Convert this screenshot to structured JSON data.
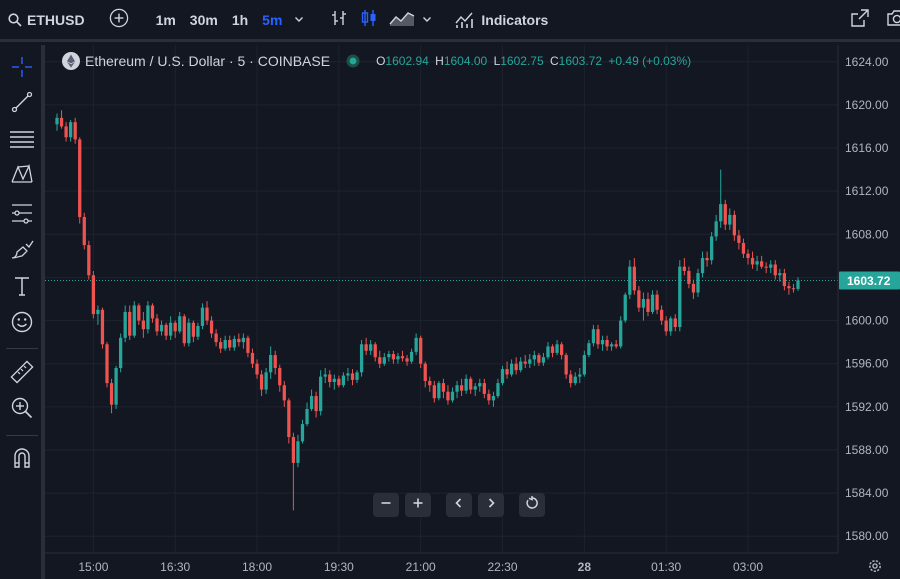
{
  "topbar": {
    "symbol": "ETHUSD",
    "timeframes": [
      {
        "label": "1m",
        "active": false
      },
      {
        "label": "30m",
        "active": false
      },
      {
        "label": "1h",
        "active": false
      },
      {
        "label": "5m",
        "active": true
      }
    ],
    "indicators_label": "Indicators"
  },
  "legend": {
    "title": "Ethereum / U.S. Dollar · 5 · COINBASE",
    "o_label": "O",
    "o_value": "1602.94",
    "h_label": "H",
    "h_value": "1604.00",
    "l_label": "L",
    "l_value": "1602.75",
    "c_label": "C",
    "c_value": "1603.72",
    "change": "+0.49 (+0.03%)"
  },
  "colors": {
    "up": "#26a69a",
    "down": "#ef5350",
    "background": "#131722",
    "grid": "#1f232e",
    "accent": "#2962ff"
  },
  "chart_data": {
    "type": "candlestick",
    "symbol": "ETHUSD",
    "interval": "5",
    "exchange": "COINBASE",
    "ylim": [
      1579,
      1625
    ],
    "y_ticks": [
      "1624.00",
      "1620.00",
      "1616.00",
      "1612.00",
      "1608.00",
      "1604.00",
      "1600.00",
      "1596.00",
      "1592.00",
      "1588.00",
      "1584.00",
      "1580.00"
    ],
    "x_ticks": [
      "15:00",
      "16:30",
      "18:00",
      "19:30",
      "21:00",
      "22:30",
      "28",
      "01:30",
      "03:00"
    ],
    "last_price": "1603.72",
    "candles": [
      [
        1618.2,
        1619.2,
        1617.6,
        1618.8
      ],
      [
        1618.8,
        1619.5,
        1617.8,
        1618.0
      ],
      [
        1618.0,
        1618.4,
        1616.6,
        1617.0
      ],
      [
        1617.0,
        1618.6,
        1616.6,
        1618.4
      ],
      [
        1618.4,
        1618.8,
        1616.4,
        1616.8
      ],
      [
        1616.8,
        1617.0,
        1609.0,
        1609.6
      ],
      [
        1609.6,
        1610.0,
        1606.6,
        1607.0
      ],
      [
        1607.0,
        1607.4,
        1603.8,
        1604.2
      ],
      [
        1604.2,
        1604.6,
        1600.2,
        1600.6
      ],
      [
        1600.6,
        1601.4,
        1599.6,
        1601.0
      ],
      [
        1601.0,
        1601.2,
        1597.4,
        1597.8
      ],
      [
        1597.8,
        1598.0,
        1593.8,
        1594.2
      ],
      [
        1594.2,
        1594.6,
        1591.4,
        1592.2
      ],
      [
        1592.2,
        1595.8,
        1591.8,
        1595.6
      ],
      [
        1595.6,
        1598.8,
        1595.2,
        1598.4
      ],
      [
        1598.4,
        1601.4,
        1598.0,
        1600.8
      ],
      [
        1600.8,
        1601.4,
        1598.2,
        1598.6
      ],
      [
        1598.6,
        1601.8,
        1598.4,
        1601.4
      ],
      [
        1601.4,
        1601.6,
        1599.6,
        1600.0
      ],
      [
        1600.0,
        1600.8,
        1598.4,
        1599.2
      ],
      [
        1599.2,
        1601.8,
        1598.8,
        1601.4
      ],
      [
        1601.4,
        1601.6,
        1599.8,
        1600.2
      ],
      [
        1600.2,
        1600.6,
        1598.6,
        1599.0
      ],
      [
        1599.0,
        1600.0,
        1598.6,
        1599.6
      ],
      [
        1599.6,
        1599.8,
        1598.2,
        1598.6
      ],
      [
        1598.6,
        1600.4,
        1598.2,
        1599.8
      ],
      [
        1599.8,
        1600.0,
        1598.4,
        1599.0
      ],
      [
        1599.0,
        1600.8,
        1598.8,
        1600.4
      ],
      [
        1600.4,
        1600.6,
        1597.6,
        1597.9
      ],
      [
        1597.9,
        1600.2,
        1597.6,
        1599.8
      ],
      [
        1599.8,
        1600.0,
        1598.0,
        1598.5
      ],
      [
        1598.5,
        1599.8,
        1598.2,
        1599.5
      ],
      [
        1599.5,
        1601.6,
        1599.2,
        1601.2
      ],
      [
        1601.2,
        1601.8,
        1599.6,
        1600.0
      ],
      [
        1600.0,
        1600.4,
        1598.4,
        1598.8
      ],
      [
        1598.8,
        1599.2,
        1597.6,
        1598.0
      ],
      [
        1598.0,
        1598.4,
        1597.0,
        1597.4
      ],
      [
        1597.4,
        1598.6,
        1597.2,
        1598.2
      ],
      [
        1598.2,
        1598.6,
        1597.2,
        1597.5
      ],
      [
        1597.5,
        1598.6,
        1597.2,
        1598.3
      ],
      [
        1598.3,
        1598.8,
        1597.6,
        1598.0
      ],
      [
        1598.0,
        1598.8,
        1597.4,
        1598.4
      ],
      [
        1598.4,
        1598.6,
        1596.6,
        1597.0
      ],
      [
        1597.0,
        1597.4,
        1595.6,
        1596.0
      ],
      [
        1596.0,
        1596.4,
        1594.6,
        1595.0
      ],
      [
        1595.0,
        1595.4,
        1593.0,
        1593.6
      ],
      [
        1593.6,
        1595.6,
        1593.2,
        1595.2
      ],
      [
        1595.2,
        1597.6,
        1594.6,
        1596.8
      ],
      [
        1596.8,
        1597.2,
        1595.0,
        1595.6
      ],
      [
        1595.6,
        1595.9,
        1593.4,
        1594.0
      ],
      [
        1594.0,
        1594.4,
        1592.0,
        1592.6
      ],
      [
        1592.6,
        1592.8,
        1588.6,
        1589.2
      ],
      [
        1589.2,
        1589.6,
        1582.4,
        1586.8
      ],
      [
        1586.8,
        1589.4,
        1586.4,
        1588.8
      ],
      [
        1588.8,
        1590.8,
        1588.6,
        1590.4
      ],
      [
        1590.4,
        1592.4,
        1590.2,
        1591.8
      ],
      [
        1591.8,
        1593.6,
        1591.6,
        1593.0
      ],
      [
        1593.0,
        1593.4,
        1591.0,
        1591.6
      ],
      [
        1591.6,
        1595.4,
        1591.2,
        1594.8
      ],
      [
        1594.8,
        1595.6,
        1594.2,
        1595.0
      ],
      [
        1595.0,
        1595.4,
        1593.8,
        1594.3
      ],
      [
        1594.3,
        1595.0,
        1593.6,
        1594.6
      ],
      [
        1594.6,
        1594.9,
        1593.8,
        1594.0
      ],
      [
        1594.0,
        1595.2,
        1593.8,
        1594.9
      ],
      [
        1594.9,
        1595.6,
        1594.4,
        1595.1
      ],
      [
        1595.1,
        1595.5,
        1594.0,
        1594.5
      ],
      [
        1594.5,
        1595.4,
        1594.2,
        1595.2
      ],
      [
        1595.2,
        1598.2,
        1594.8,
        1597.8
      ],
      [
        1597.8,
        1598.4,
        1596.8,
        1597.2
      ],
      [
        1597.2,
        1598.2,
        1596.8,
        1597.8
      ],
      [
        1597.8,
        1598.0,
        1596.2,
        1596.6
      ],
      [
        1596.6,
        1597.2,
        1595.6,
        1596.0
      ],
      [
        1596.0,
        1597.0,
        1595.8,
        1596.6
      ],
      [
        1596.6,
        1597.2,
        1596.2,
        1596.9
      ],
      [
        1596.9,
        1597.2,
        1596.0,
        1596.4
      ],
      [
        1596.4,
        1597.0,
        1596.0,
        1596.7
      ],
      [
        1596.7,
        1597.2,
        1596.2,
        1596.5
      ],
      [
        1596.5,
        1596.8,
        1595.8,
        1596.2
      ],
      [
        1596.2,
        1597.4,
        1596.0,
        1597.1
      ],
      [
        1597.1,
        1598.8,
        1596.8,
        1598.4
      ],
      [
        1598.4,
        1598.6,
        1595.6,
        1596.0
      ],
      [
        1596.0,
        1596.2,
        1593.8,
        1594.4
      ],
      [
        1594.4,
        1594.8,
        1593.4,
        1594.0
      ],
      [
        1594.0,
        1594.4,
        1592.4,
        1592.8
      ],
      [
        1592.8,
        1594.4,
        1592.6,
        1594.2
      ],
      [
        1594.2,
        1594.6,
        1592.8,
        1593.4
      ],
      [
        1593.4,
        1594.0,
        1592.2,
        1592.6
      ],
      [
        1592.6,
        1593.8,
        1592.4,
        1593.4
      ],
      [
        1593.4,
        1594.4,
        1592.8,
        1594.0
      ],
      [
        1594.0,
        1594.6,
        1593.0,
        1593.5
      ],
      [
        1593.5,
        1595.0,
        1593.2,
        1594.6
      ],
      [
        1594.6,
        1594.8,
        1593.2,
        1593.6
      ],
      [
        1593.6,
        1594.2,
        1593.0,
        1593.9
      ],
      [
        1593.9,
        1594.6,
        1593.4,
        1594.2
      ],
      [
        1594.2,
        1594.6,
        1592.8,
        1593.2
      ],
      [
        1593.2,
        1593.6,
        1592.2,
        1592.6
      ],
      [
        1592.6,
        1593.4,
        1592.0,
        1593.0
      ],
      [
        1593.0,
        1594.6,
        1592.8,
        1594.2
      ],
      [
        1594.2,
        1595.8,
        1594.0,
        1595.5
      ],
      [
        1595.5,
        1596.2,
        1594.6,
        1595.0
      ],
      [
        1595.0,
        1596.4,
        1594.8,
        1596.0
      ],
      [
        1596.0,
        1596.6,
        1595.0,
        1595.4
      ],
      [
        1595.4,
        1596.6,
        1595.2,
        1596.2
      ],
      [
        1596.2,
        1596.8,
        1595.6,
        1596.0
      ],
      [
        1596.0,
        1596.9,
        1595.6,
        1596.4
      ],
      [
        1596.4,
        1597.2,
        1595.8,
        1596.8
      ],
      [
        1596.8,
        1597.0,
        1595.8,
        1596.1
      ],
      [
        1596.1,
        1597.0,
        1595.8,
        1596.6
      ],
      [
        1596.6,
        1598.0,
        1596.4,
        1597.6
      ],
      [
        1597.6,
        1597.8,
        1596.6,
        1597.0
      ],
      [
        1597.0,
        1598.2,
        1596.8,
        1597.8
      ],
      [
        1597.8,
        1598.0,
        1596.4,
        1596.8
      ],
      [
        1596.8,
        1597.0,
        1594.6,
        1595.0
      ],
      [
        1595.0,
        1595.4,
        1593.8,
        1594.2
      ],
      [
        1594.2,
        1595.2,
        1594.0,
        1594.8
      ],
      [
        1594.8,
        1595.6,
        1594.2,
        1595.0
      ],
      [
        1595.0,
        1597.2,
        1594.8,
        1596.8
      ],
      [
        1596.8,
        1598.2,
        1596.6,
        1597.9
      ],
      [
        1597.9,
        1599.6,
        1597.6,
        1599.2
      ],
      [
        1599.2,
        1599.6,
        1597.4,
        1597.8
      ],
      [
        1597.8,
        1598.6,
        1597.2,
        1598.2
      ],
      [
        1598.2,
        1598.6,
        1597.2,
        1597.6
      ],
      [
        1597.6,
        1598.0,
        1597.2,
        1597.8
      ],
      [
        1597.8,
        1598.2,
        1597.4,
        1597.6
      ],
      [
        1597.6,
        1600.4,
        1597.4,
        1600.0
      ],
      [
        1600.0,
        1602.6,
        1599.8,
        1602.4
      ],
      [
        1602.4,
        1605.6,
        1602.0,
        1605.0
      ],
      [
        1605.0,
        1605.8,
        1602.4,
        1602.8
      ],
      [
        1602.8,
        1603.2,
        1600.8,
        1601.2
      ],
      [
        1601.2,
        1602.6,
        1600.0,
        1602.0
      ],
      [
        1602.0,
        1602.6,
        1600.4,
        1600.8
      ],
      [
        1600.8,
        1602.8,
        1600.6,
        1602.4
      ],
      [
        1602.4,
        1602.8,
        1600.6,
        1601.0
      ],
      [
        1601.0,
        1601.4,
        1599.6,
        1600.0
      ],
      [
        1600.0,
        1600.4,
        1598.6,
        1599.0
      ],
      [
        1599.0,
        1600.4,
        1598.6,
        1600.2
      ],
      [
        1600.2,
        1600.6,
        1599.0,
        1599.4
      ],
      [
        1599.4,
        1605.6,
        1599.0,
        1605.0
      ],
      [
        1605.0,
        1605.8,
        1604.2,
        1604.6
      ],
      [
        1604.6,
        1605.0,
        1603.0,
        1603.4
      ],
      [
        1603.4,
        1603.8,
        1602.0,
        1602.6
      ],
      [
        1602.6,
        1604.8,
        1602.2,
        1604.4
      ],
      [
        1604.4,
        1606.4,
        1604.0,
        1605.8
      ],
      [
        1605.8,
        1606.4,
        1605.0,
        1605.6
      ],
      [
        1605.6,
        1608.2,
        1605.2,
        1607.8
      ],
      [
        1607.8,
        1609.8,
        1607.4,
        1609.2
      ],
      [
        1609.2,
        1614.0,
        1608.6,
        1610.8
      ],
      [
        1610.8,
        1611.2,
        1608.4,
        1608.9
      ],
      [
        1608.9,
        1610.4,
        1608.4,
        1609.8
      ],
      [
        1609.8,
        1610.2,
        1607.4,
        1607.9
      ],
      [
        1607.9,
        1608.4,
        1606.6,
        1607.2
      ],
      [
        1607.2,
        1607.6,
        1605.8,
        1606.2
      ],
      [
        1606.2,
        1606.6,
        1605.2,
        1605.8
      ],
      [
        1605.8,
        1606.4,
        1604.8,
        1605.2
      ],
      [
        1605.2,
        1606.0,
        1604.6,
        1605.5
      ],
      [
        1605.5,
        1606.0,
        1604.8,
        1605.0
      ],
      [
        1605.0,
        1605.4,
        1604.4,
        1604.9
      ],
      [
        1604.9,
        1605.6,
        1604.4,
        1605.2
      ],
      [
        1605.2,
        1605.6,
        1603.8,
        1604.2
      ],
      [
        1604.2,
        1604.8,
        1603.6,
        1604.4
      ],
      [
        1604.4,
        1604.8,
        1602.8,
        1603.2
      ],
      [
        1603.2,
        1603.6,
        1602.4,
        1603.0
      ],
      [
        1603.0,
        1603.4,
        1602.6,
        1602.9
      ],
      [
        1602.94,
        1604.0,
        1602.75,
        1603.72
      ]
    ]
  }
}
